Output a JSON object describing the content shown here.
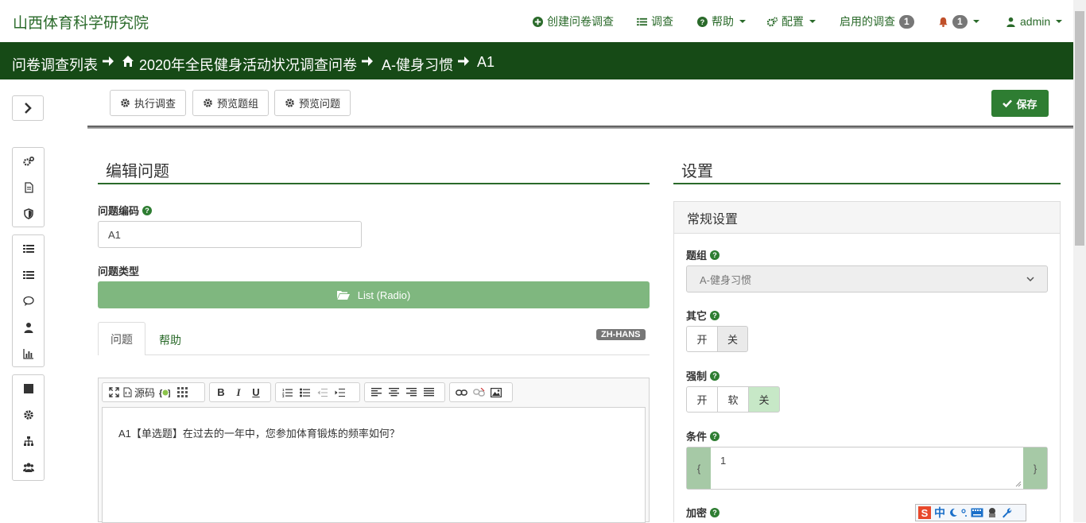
{
  "brand": "山西体育科学研究院",
  "nav": {
    "create_survey": "创建问卷调查",
    "surveys": "调查",
    "help": "帮助",
    "config": "配置",
    "active_surveys": "启用的调查",
    "active_count": "1",
    "notifications_count": "1",
    "user": "admin"
  },
  "breadcrumb": [
    "问卷调查列表",
    "2020年全民健身活动状况调查问卷",
    "A-健身习惯",
    "A1"
  ],
  "toolbar": {
    "execute": "执行调查",
    "preview_group": "预览题组",
    "preview_question": "预览问题",
    "save": "保存"
  },
  "editor": {
    "heading": "编辑问题",
    "code_label": "问题编码",
    "code_value": "A1",
    "type_label": "问题类型",
    "type_value": "List (Radio)",
    "tabs": [
      "问题",
      "帮助"
    ],
    "language": "ZH-HANS",
    "source_label": "源码",
    "question_text": "A1【单选题】在过去的一年中，您参加体育锻炼的频率如何？"
  },
  "settings": {
    "heading": "设置",
    "panel_title": "常规设置",
    "group_label": "题组",
    "group_value": "A-健身习惯",
    "other_label": "其它",
    "other_options": [
      "开",
      "关"
    ],
    "mandatory_label": "强制",
    "mandatory_options": [
      "开",
      "软",
      "关"
    ],
    "condition_label": "条件",
    "condition_value": "1",
    "condition_open": "{",
    "condition_close": "}",
    "encrypt_label": "加密"
  },
  "ime": {
    "lang": "中"
  },
  "colors": {
    "brand_green": "#2a6a2a",
    "bar_green": "#164a16",
    "button_green": "#2e7d32",
    "type_green": "#7fb77f"
  }
}
